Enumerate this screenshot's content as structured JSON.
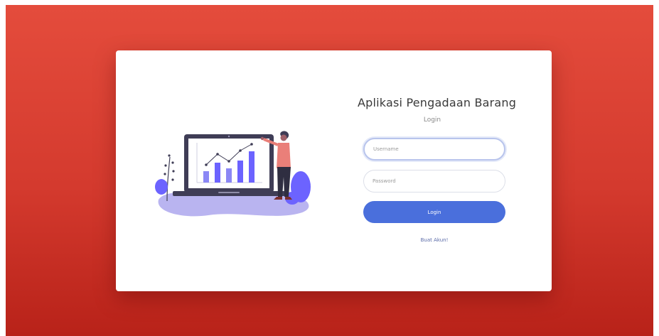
{
  "app": {
    "title": "Aplikasi Pengadaan Barang",
    "subtitle": "Login"
  },
  "form": {
    "username": {
      "placeholder": "Username",
      "value": ""
    },
    "password": {
      "placeholder": "Password",
      "value": ""
    },
    "login_button": "Login",
    "register_link": "Buat Akun!"
  },
  "colors": {
    "background_top": "#e44c3c",
    "background_bottom": "#b82219",
    "primary": "#4a6fdc",
    "accent_purple": "#6c63ff"
  },
  "illustration": {
    "icon": "presentation-chart-icon"
  }
}
